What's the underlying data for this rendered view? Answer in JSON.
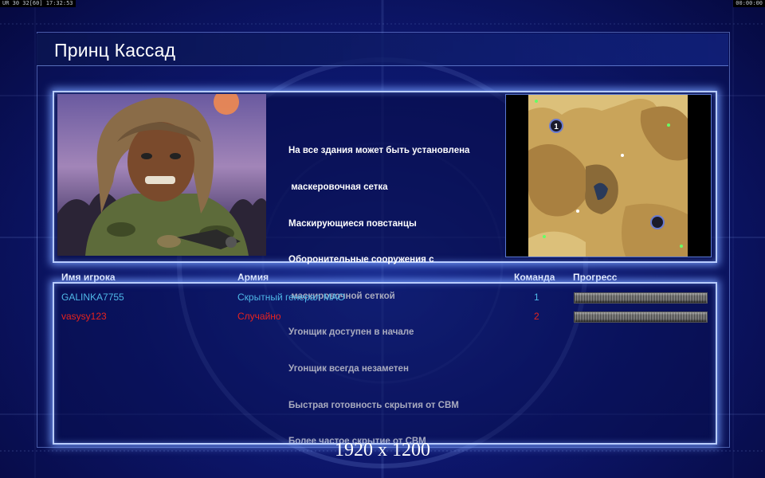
{
  "overlay": {
    "top_left": "UR 30 32[60] 17:32:53",
    "top_right": "00:00:00"
  },
  "header": {
    "title": "Принц Кассад"
  },
  "general": {
    "features": [
      "На все здания может быть установлена",
      " маскеровочная сетка",
      "Маскирующиеся повстанцы",
      "Оборонительные сооружения с",
      " маскировочной сеткой",
      "Угонщик доступен в начале",
      "Угонщик всегда незаметен",
      "Быстрая готовность скрытия от СВМ",
      "Более частое скрытие от СВМ"
    ]
  },
  "minimap": {
    "start_marker_label": "1"
  },
  "players_table": {
    "headers": {
      "name": "Имя игрока",
      "army": "Армия",
      "team": "Команда",
      "progress": "Прогресс"
    },
    "rows": [
      {
        "name": "GALINKA7755",
        "army": "Скрытный генерал МАО",
        "team": "1",
        "color": "#4fb8e8",
        "progress": 1.0
      },
      {
        "name": "vasysy123",
        "army": "Случайно",
        "team": "2",
        "color": "#e8231e",
        "progress": 1.0
      }
    ]
  },
  "resolution_label": "1920 x 1200",
  "colors": {
    "background": "#08104a",
    "panel_border": "#b8ccff",
    "player1": "#4fb8e8",
    "player2": "#e8231e"
  }
}
